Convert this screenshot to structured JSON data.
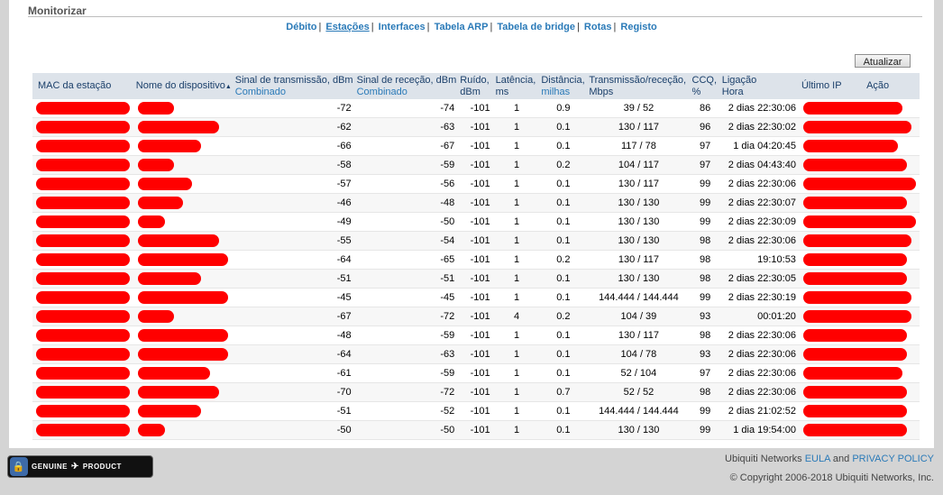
{
  "section_title": "Monitorizar",
  "tabs": [
    {
      "label": "Débito",
      "active": false
    },
    {
      "label": "Estações",
      "active": true
    },
    {
      "label": "Interfaces",
      "active": false
    },
    {
      "label": "Tabela ARP",
      "active": false
    },
    {
      "label": "Tabela de bridge",
      "active": false
    },
    {
      "label": "Rotas",
      "active": false
    },
    {
      "label": "Registo",
      "active": false
    }
  ],
  "refresh_label": "Atualizar",
  "columns": {
    "mac": "MAC da estação",
    "device": "Nome do dispositivo",
    "sort_icon": "sort-ascending-icon",
    "tx_signal": "Sinal de transmissão, dBm",
    "tx_signal_sub": "Combinado",
    "rx_signal": "Sinal de receção, dBm",
    "rx_signal_sub": "Combinado",
    "noise_l1": "Ruído,",
    "noise_l2": "dBm",
    "latency_l1": "Latência,",
    "latency_l2": "ms",
    "distance_l1": "Distância,",
    "distance_l2": "milhas",
    "rate_l1": "Transmissão/receção,",
    "rate_l2": "Mbps",
    "ccq_l1": "CCQ,",
    "ccq_l2": "%",
    "conn_l1": "Ligação",
    "conn_l2": "Hora",
    "last_ip": "Último IP",
    "action": "Ação"
  },
  "rows": [
    {
      "tx": "-72",
      "rx": "-74",
      "noise": "-101",
      "lat": "1",
      "dist": "0.9",
      "rate": "39 / 52",
      "ccq": "86",
      "conn": "2 dias 22:30:06"
    },
    {
      "tx": "-62",
      "rx": "-63",
      "noise": "-101",
      "lat": "1",
      "dist": "0.1",
      "rate": "130 / 117",
      "ccq": "96",
      "conn": "2 dias 22:30:02"
    },
    {
      "tx": "-66",
      "rx": "-67",
      "noise": "-101",
      "lat": "1",
      "dist": "0.1",
      "rate": "117 / 78",
      "ccq": "97",
      "conn": "1 dia 04:20:45"
    },
    {
      "tx": "-58",
      "rx": "-59",
      "noise": "-101",
      "lat": "1",
      "dist": "0.2",
      "rate": "104 / 117",
      "ccq": "97",
      "conn": "2 dias 04:43:40"
    },
    {
      "tx": "-57",
      "rx": "-56",
      "noise": "-101",
      "lat": "1",
      "dist": "0.1",
      "rate": "130 / 117",
      "ccq": "99",
      "conn": "2 dias 22:30:06"
    },
    {
      "tx": "-46",
      "rx": "-48",
      "noise": "-101",
      "lat": "1",
      "dist": "0.1",
      "rate": "130 / 130",
      "ccq": "99",
      "conn": "2 dias 22:30:07"
    },
    {
      "tx": "-49",
      "rx": "-50",
      "noise": "-101",
      "lat": "1",
      "dist": "0.1",
      "rate": "130 / 130",
      "ccq": "99",
      "conn": "2 dias 22:30:09"
    },
    {
      "tx": "-55",
      "rx": "-54",
      "noise": "-101",
      "lat": "1",
      "dist": "0.1",
      "rate": "130 / 130",
      "ccq": "98",
      "conn": "2 dias 22:30:06"
    },
    {
      "tx": "-64",
      "rx": "-65",
      "noise": "-101",
      "lat": "1",
      "dist": "0.2",
      "rate": "130 / 117",
      "ccq": "98",
      "conn": "19:10:53"
    },
    {
      "tx": "-51",
      "rx": "-51",
      "noise": "-101",
      "lat": "1",
      "dist": "0.1",
      "rate": "130 / 130",
      "ccq": "98",
      "conn": "2 dias 22:30:05"
    },
    {
      "tx": "-45",
      "rx": "-45",
      "noise": "-101",
      "lat": "1",
      "dist": "0.1",
      "rate": "144.444 / 144.444",
      "ccq": "99",
      "conn": "2 dias 22:30:19"
    },
    {
      "tx": "-67",
      "rx": "-72",
      "noise": "-101",
      "lat": "4",
      "dist": "0.2",
      "rate": "104 / 39",
      "ccq": "93",
      "conn": "00:01:20"
    },
    {
      "tx": "-48",
      "rx": "-59",
      "noise": "-101",
      "lat": "1",
      "dist": "0.1",
      "rate": "130 / 117",
      "ccq": "98",
      "conn": "2 dias 22:30:06"
    },
    {
      "tx": "-64",
      "rx": "-63",
      "noise": "-101",
      "lat": "1",
      "dist": "0.1",
      "rate": "104 / 78",
      "ccq": "93",
      "conn": "2 dias 22:30:06"
    },
    {
      "tx": "-61",
      "rx": "-59",
      "noise": "-101",
      "lat": "1",
      "dist": "0.1",
      "rate": "52 / 104",
      "ccq": "97",
      "conn": "2 dias 22:30:06"
    },
    {
      "tx": "-70",
      "rx": "-72",
      "noise": "-101",
      "lat": "1",
      "dist": "0.7",
      "rate": "52 / 52",
      "ccq": "98",
      "conn": "2 dias 22:30:06"
    },
    {
      "tx": "-51",
      "rx": "-52",
      "noise": "-101",
      "lat": "1",
      "dist": "0.1",
      "rate": "144.444 / 144.444",
      "ccq": "99",
      "conn": "2 dias 21:02:52"
    },
    {
      "tx": "-50",
      "rx": "-50",
      "noise": "-101",
      "lat": "1",
      "dist": "0.1",
      "rate": "130 / 130",
      "ccq": "99",
      "conn": "1 dia 19:54:00"
    }
  ],
  "redaction_color": "#ff0000",
  "footer": {
    "badge_genuine": "GENUINE",
    "badge_product": "PRODUCT",
    "badge_icon": "lock-icon",
    "company": "Ubiquiti Networks",
    "eula": "EULA",
    "and": "and",
    "privacy": "PRIVACY POLICY",
    "copyright": "© Copyright 2006-2018 Ubiquiti Networks, Inc."
  }
}
